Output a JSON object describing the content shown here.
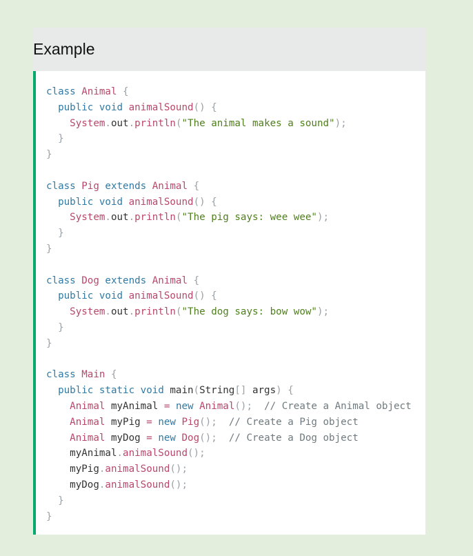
{
  "header": {
    "title": "Example"
  },
  "code_lines": [
    [
      [
        "class ",
        "kw"
      ],
      [
        "Animal ",
        "cls"
      ],
      [
        "{",
        "pun"
      ]
    ],
    [
      [
        "  public void ",
        "kw"
      ],
      [
        "animalSound",
        "cls"
      ],
      [
        "() {",
        "pun"
      ]
    ],
    [
      [
        "    System",
        "cls"
      ],
      [
        ".",
        "pun"
      ],
      [
        "out",
        "tx"
      ],
      [
        ".",
        "pun"
      ],
      [
        "println",
        "cls"
      ],
      [
        "(",
        "pun"
      ],
      [
        "\"The animal makes a sound\"",
        "str"
      ],
      [
        ");",
        "pun"
      ]
    ],
    [
      [
        "  }",
        "pun"
      ]
    ],
    [
      [
        "}",
        "pun"
      ]
    ],
    [],
    [
      [
        "class ",
        "kw"
      ],
      [
        "Pig ",
        "cls"
      ],
      [
        "extends ",
        "kw"
      ],
      [
        "Animal ",
        "cls"
      ],
      [
        "{",
        "pun"
      ]
    ],
    [
      [
        "  public void ",
        "kw"
      ],
      [
        "animalSound",
        "cls"
      ],
      [
        "() {",
        "pun"
      ]
    ],
    [
      [
        "    System",
        "cls"
      ],
      [
        ".",
        "pun"
      ],
      [
        "out",
        "tx"
      ],
      [
        ".",
        "pun"
      ],
      [
        "println",
        "cls"
      ],
      [
        "(",
        "pun"
      ],
      [
        "\"The pig says: wee wee\"",
        "str"
      ],
      [
        ");",
        "pun"
      ]
    ],
    [
      [
        "  }",
        "pun"
      ]
    ],
    [
      [
        "}",
        "pun"
      ]
    ],
    [],
    [
      [
        "class ",
        "kw"
      ],
      [
        "Dog ",
        "cls"
      ],
      [
        "extends ",
        "kw"
      ],
      [
        "Animal ",
        "cls"
      ],
      [
        "{",
        "pun"
      ]
    ],
    [
      [
        "  public void ",
        "kw"
      ],
      [
        "animalSound",
        "cls"
      ],
      [
        "() {",
        "pun"
      ]
    ],
    [
      [
        "    System",
        "cls"
      ],
      [
        ".",
        "pun"
      ],
      [
        "out",
        "tx"
      ],
      [
        ".",
        "pun"
      ],
      [
        "println",
        "cls"
      ],
      [
        "(",
        "pun"
      ],
      [
        "\"The dog says: bow wow\"",
        "str"
      ],
      [
        ");",
        "pun"
      ]
    ],
    [
      [
        "  }",
        "pun"
      ]
    ],
    [
      [
        "}",
        "pun"
      ]
    ],
    [],
    [
      [
        "class ",
        "kw"
      ],
      [
        "Main ",
        "cls"
      ],
      [
        "{",
        "pun"
      ]
    ],
    [
      [
        "  public static void ",
        "kw"
      ],
      [
        "main",
        "tx"
      ],
      [
        "(",
        "pun"
      ],
      [
        "String",
        "tx"
      ],
      [
        "[] ",
        "pun"
      ],
      [
        "args",
        "tx"
      ],
      [
        ") {",
        "pun"
      ]
    ],
    [
      [
        "    Animal ",
        "cls"
      ],
      [
        "myAnimal ",
        "tx"
      ],
      [
        "= ",
        "cls"
      ],
      [
        "new ",
        "kw"
      ],
      [
        "Animal",
        "cls"
      ],
      [
        "();  ",
        "pun"
      ],
      [
        "// Create a Animal object",
        "cm"
      ]
    ],
    [
      [
        "    Animal ",
        "cls"
      ],
      [
        "myPig ",
        "tx"
      ],
      [
        "= ",
        "cls"
      ],
      [
        "new ",
        "kw"
      ],
      [
        "Pig",
        "cls"
      ],
      [
        "();  ",
        "pun"
      ],
      [
        "// Create a Pig object",
        "cm"
      ]
    ],
    [
      [
        "    Animal ",
        "cls"
      ],
      [
        "myDog ",
        "tx"
      ],
      [
        "= ",
        "cls"
      ],
      [
        "new ",
        "kw"
      ],
      [
        "Dog",
        "cls"
      ],
      [
        "();  ",
        "pun"
      ],
      [
        "// Create a Dog object",
        "cm"
      ]
    ],
    [
      [
        "    myAnimal",
        "tx"
      ],
      [
        ".",
        "pun"
      ],
      [
        "animalSound",
        "cls"
      ],
      [
        "();",
        "pun"
      ]
    ],
    [
      [
        "    myPig",
        "tx"
      ],
      [
        ".",
        "pun"
      ],
      [
        "animalSound",
        "cls"
      ],
      [
        "();",
        "pun"
      ]
    ],
    [
      [
        "    myDog",
        "tx"
      ],
      [
        ".",
        "pun"
      ],
      [
        "animalSound",
        "cls"
      ],
      [
        "();",
        "pun"
      ]
    ],
    [
      [
        "  }",
        "pun"
      ]
    ],
    [
      [
        "}",
        "pun"
      ]
    ]
  ]
}
